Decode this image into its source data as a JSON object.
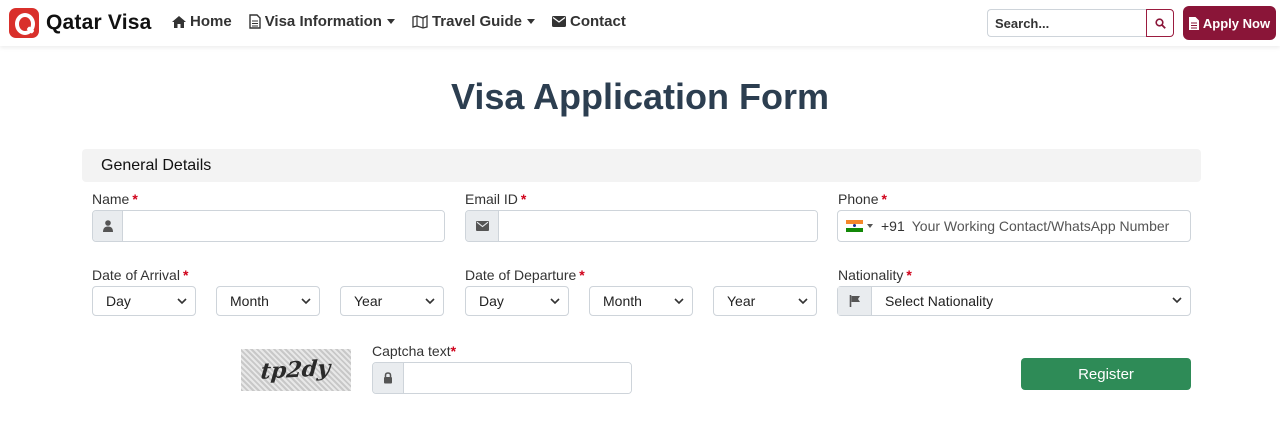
{
  "brand": {
    "name": "Qatar Visa"
  },
  "nav": {
    "home": "Home",
    "visa_info": "Visa Information",
    "travel_guide": "Travel Guide",
    "contact": "Contact"
  },
  "search": {
    "placeholder": "Search..."
  },
  "apply_label": "Apply Now",
  "page_title": "Visa Application Form",
  "section": {
    "general": "General Details"
  },
  "form": {
    "name_label": "Name",
    "email_label": "Email ID",
    "phone_label": "Phone",
    "phone_dial": "+91",
    "phone_placeholder": "Your Working Contact/WhatsApp Number",
    "arrival_label": "Date of Arrival",
    "departure_label": "Date of Departure",
    "nationality_label": "Nationality",
    "nationality_value": "Select Nationality",
    "day": "Day",
    "month": "Month",
    "year": "Year",
    "required_mark": "*",
    "captcha_label": "Captcha text",
    "captcha_text": "tp2dy",
    "register_label": "Register"
  },
  "colors": {
    "brand_red": "#d9302b",
    "apply_maroon": "#8a1538",
    "register_green": "#2e8b57",
    "title_navy": "#2c3e50"
  },
  "icons": [
    "home-icon",
    "document-icon",
    "map-icon",
    "envelope-icon",
    "search-icon",
    "user-icon",
    "flag-icon",
    "lock-icon",
    "chevron-down-icon"
  ]
}
